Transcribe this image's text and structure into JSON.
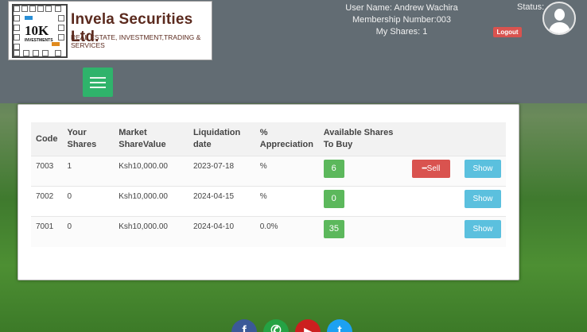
{
  "brand": {
    "company_name": "Invela Securities Ltd.",
    "tagline": "REAL ESTATE, INVESTMENT,TRADING & SERVICES",
    "logo_big_text": "10K",
    "logo_small_text": "INVESTMENTS"
  },
  "user": {
    "name_line": "User Name: Andrew Wachira",
    "membership_line": "Membership Number:003",
    "shares_line": "My Shares: 1",
    "status_label": "Status:",
    "logout_label": "Logout"
  },
  "nav": {
    "toggle_icon": "hamburger-icon"
  },
  "table": {
    "headers": {
      "code": "Code",
      "your_shares": "Your Shares",
      "market_value": "Market ShareValue",
      "liquidation": "Liquidation date",
      "appreciation": "% Appreciation",
      "available": "Available Shares To Buy"
    },
    "rows": [
      {
        "code": "7003",
        "shares": "1",
        "value": "Ksh10,000.00",
        "date": "2023-07-18",
        "appreciation": "%",
        "available": "6",
        "sell_label": "Sell",
        "show_label": "Show"
      },
      {
        "code": "7002",
        "shares": "0",
        "value": "Ksh10,000.00",
        "date": "2024-04-15",
        "appreciation": "%",
        "available": "0",
        "show_label": "Show"
      },
      {
        "code": "7001",
        "shares": "0",
        "value": "Ksh10,000.00",
        "date": "2024-04-10",
        "appreciation": "0.0%",
        "available": "35",
        "show_label": "Show"
      }
    ]
  },
  "colors": {
    "header_bg": "#626c73",
    "accent_green": "#2fb36b",
    "danger": "#d9534f",
    "info": "#5bc0de",
    "success": "#5cb85c"
  },
  "social": [
    {
      "icon": "facebook-icon",
      "glyph": "f",
      "color": "#3b5998"
    },
    {
      "icon": "whatsapp-icon",
      "glyph": "✆",
      "color": "#25a244"
    },
    {
      "icon": "youtube-icon",
      "glyph": "▶",
      "color": "#cc1f1f"
    },
    {
      "icon": "twitter-icon",
      "glyph": "t",
      "color": "#1da1f2"
    }
  ]
}
